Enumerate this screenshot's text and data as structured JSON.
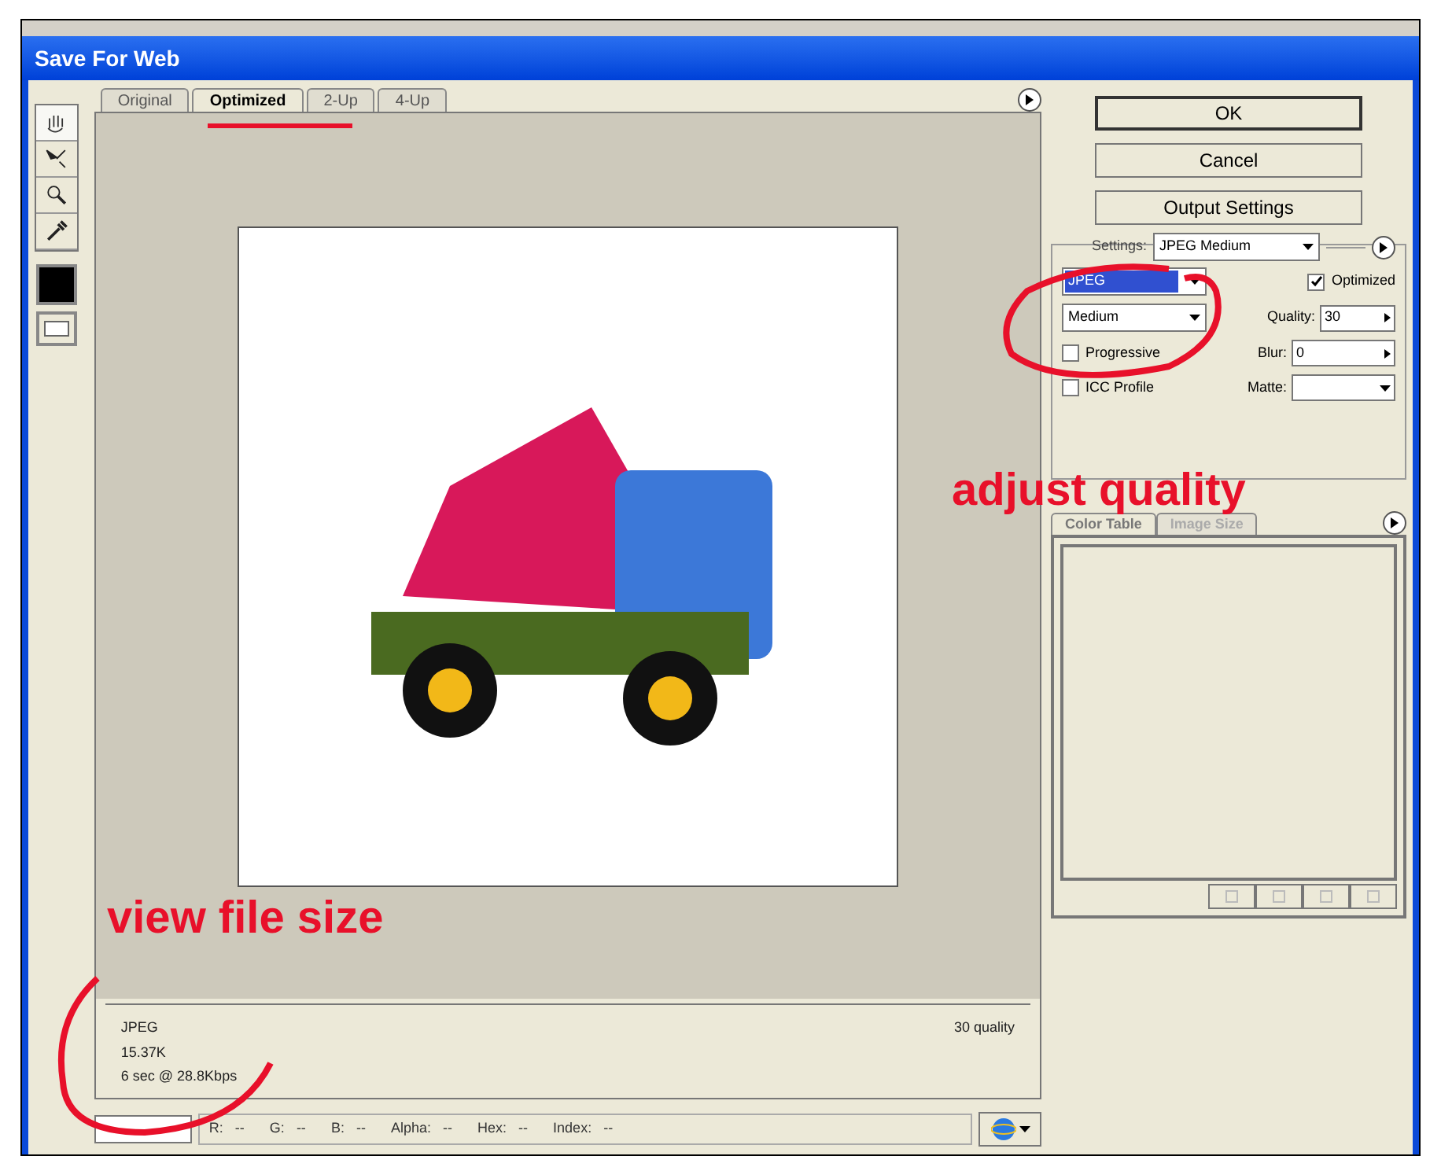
{
  "window": {
    "title": "Save For Web"
  },
  "view_tabs": [
    {
      "label": "Original",
      "selected": false
    },
    {
      "label": "Optimized",
      "selected": true
    },
    {
      "label": "2-Up",
      "selected": false
    },
    {
      "label": "4-Up",
      "selected": false
    }
  ],
  "info": {
    "format": "JPEG",
    "size": "15.37K",
    "time": "6 sec @ 28.8Kbps",
    "quality": "30 quality"
  },
  "status_bar": [
    {
      "label": "R:",
      "value": "--"
    },
    {
      "label": "G:",
      "value": "--"
    },
    {
      "label": "B:",
      "value": "--"
    },
    {
      "label": "Alpha:",
      "value": "--"
    },
    {
      "label": "Hex:",
      "value": "--"
    },
    {
      "label": "Index:",
      "value": "--"
    }
  ],
  "buttons": [
    "OK",
    "Cancel",
    "Output Settings"
  ],
  "settings": {
    "preset_label": "Settings:",
    "preset": "JPEG Medium",
    "format": "JPEG",
    "quality_preset": "Medium",
    "optimized": {
      "label": "Optimized",
      "checked": true
    },
    "quality": {
      "label": "Quality:",
      "value": "30"
    },
    "progressive": {
      "label": "Progressive",
      "checked": false
    },
    "blur": {
      "label": "Blur:",
      "value": "0"
    },
    "icc_profile": {
      "label": "ICC Profile",
      "checked": false
    },
    "matte": {
      "label": "Matte:"
    }
  },
  "panel_tabs": [
    {
      "label": "Color Table",
      "selected": true
    },
    {
      "label": "Image Size",
      "selected": false
    }
  ],
  "annotations": [
    "adjust quality",
    "view file size"
  ]
}
